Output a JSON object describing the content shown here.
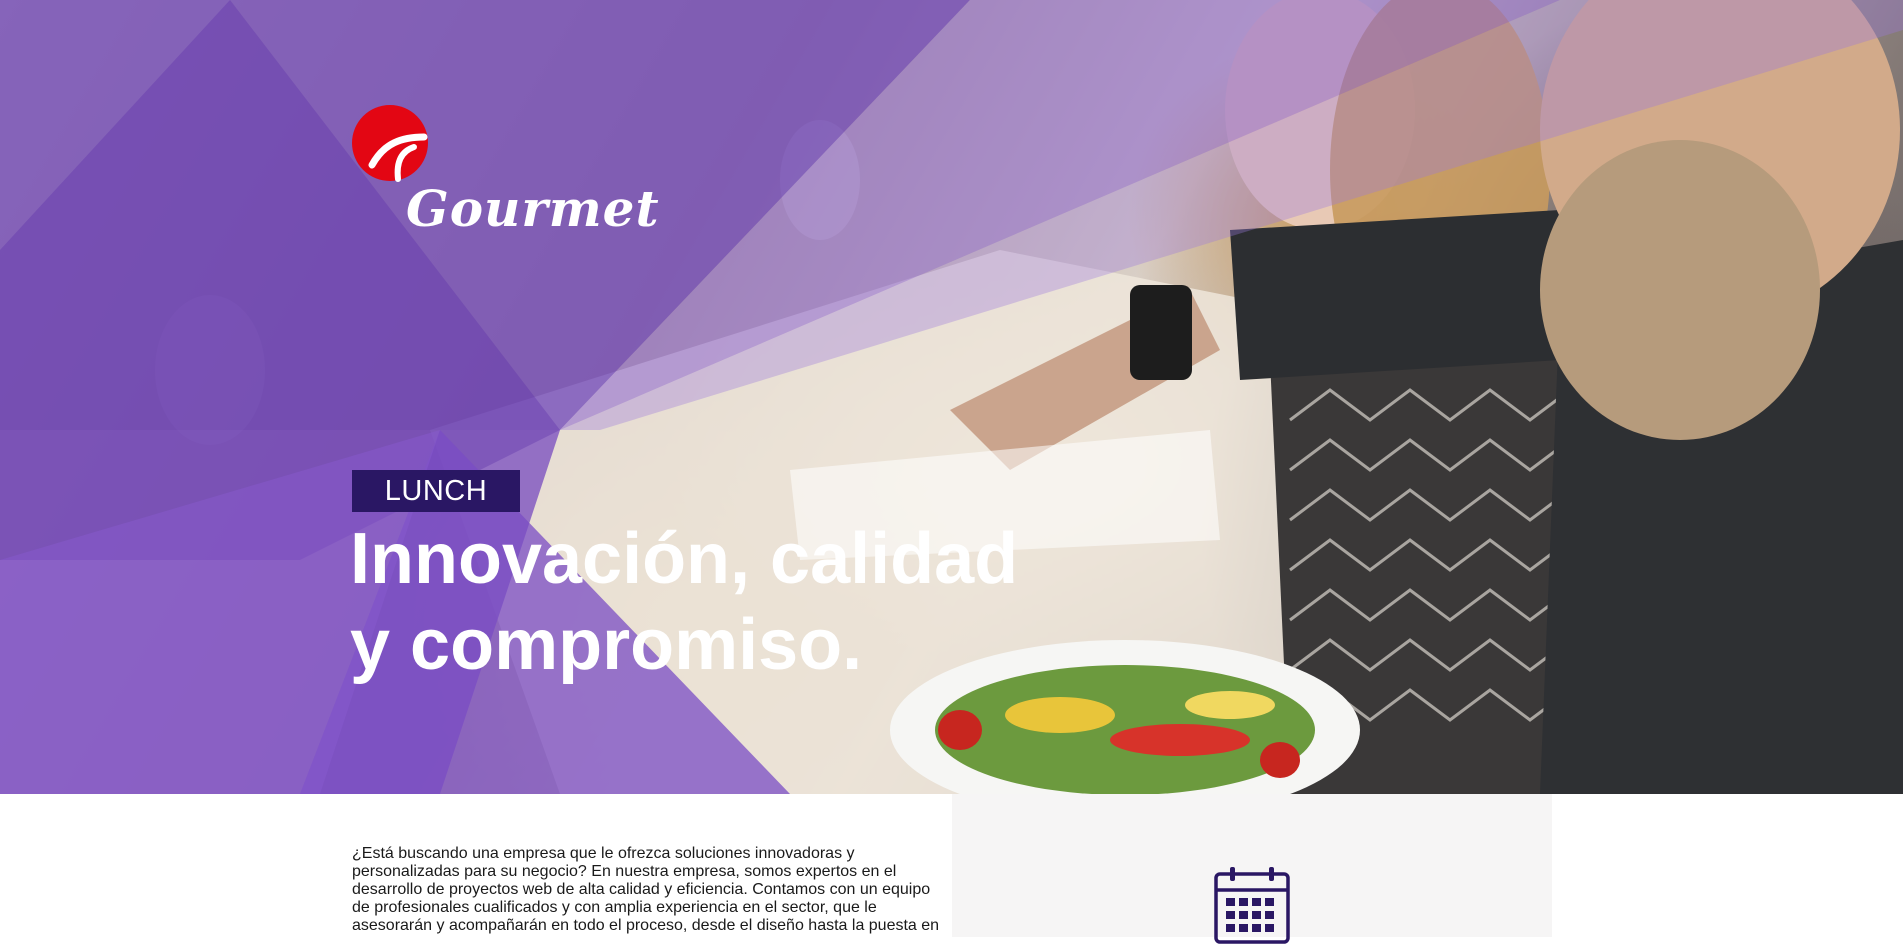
{
  "brand": {
    "name": "Gourmet",
    "accent": "#e30613",
    "primary": "#7b4fc0",
    "badge_bg": "#2a1764"
  },
  "hero": {
    "badge": "LUNCH",
    "headline_line1": "Innovación, calidad",
    "headline_line2": "y compromiso."
  },
  "content": {
    "intro": "¿Está buscando una empresa que le ofrezca soluciones innovadoras y personalizadas para su negocio? En nuestra empresa, somos expertos en el desarrollo de proyectos web de alta calidad y eficiencia. Contamos con un equipo de profesionales cualificados y con amplia experiencia en el sector, que le asesorarán y acompañarán en todo el proceso, desde el diseño hasta la puesta en"
  },
  "icons": {
    "logo": "gourmet-logo-icon",
    "calendar": "calendar-icon"
  }
}
